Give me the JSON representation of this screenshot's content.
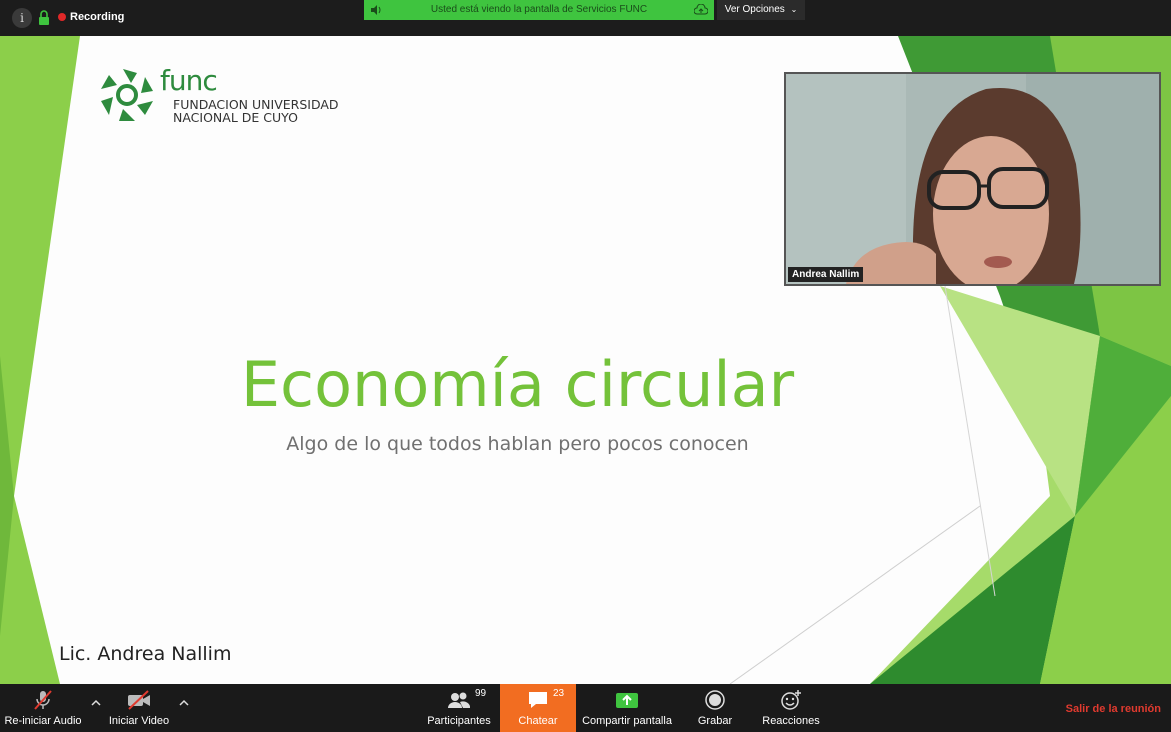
{
  "top_bar": {
    "info_icon": "info-icon",
    "lock_icon": "lock-icon",
    "recording_label": "Recording",
    "share_banner": "Usted está viendo la pantalla de Servicios FUNC",
    "view_options": "Ver Opciones"
  },
  "slide": {
    "logo_word": "func",
    "logo_line1": "FUNDACION UNIVERSIDAD",
    "logo_line2": "NACIONAL DE CUYO",
    "title": "Economía circular",
    "subtitle": "Algo de lo que todos hablan pero pocos conocen",
    "author": "Lic. Andrea Nallim"
  },
  "video": {
    "participant_name": "Andrea Nallim"
  },
  "toolbar": {
    "audio_label": "Re-iniciar Audio",
    "video_label": "Iniciar Video",
    "participants_label": "Participantes",
    "participants_count": "99",
    "chat_label": "Chatear",
    "chat_count": "23",
    "share_label": "Compartir pantalla",
    "record_label": "Grabar",
    "reactions_label": "Reacciones",
    "leave_label": "Salir de la reunión"
  },
  "colors": {
    "slide_green": "#74c23a",
    "dark_green": "#2e8b3e",
    "share_banner": "#3fc43f",
    "chat_active": "#f26d21",
    "leave_red": "#e03a2f",
    "recording_red": "#e02828"
  }
}
